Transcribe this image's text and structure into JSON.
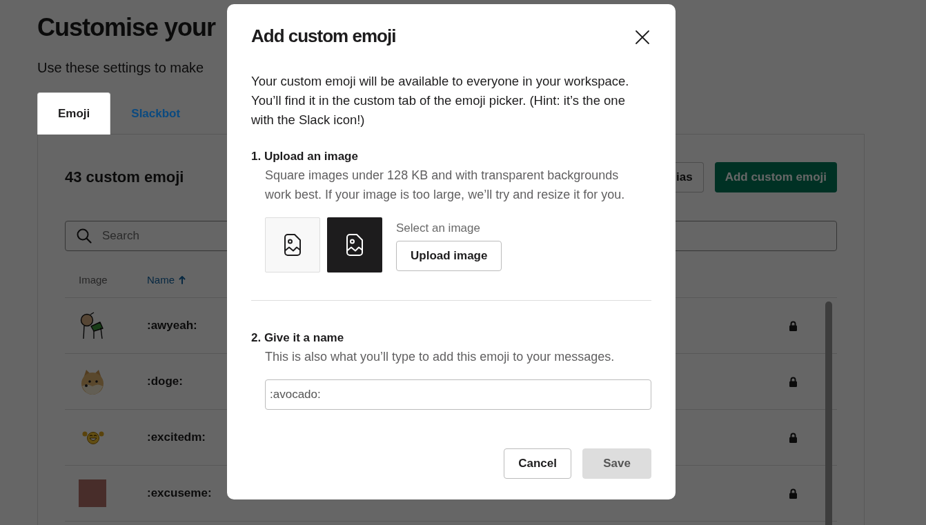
{
  "page": {
    "title": "Customise your",
    "subtitle": "Use these settings to make"
  },
  "tabs": [
    {
      "label": "Emoji",
      "selected": true
    },
    {
      "label": "Slackbot",
      "selected": false
    }
  ],
  "emoji_panel": {
    "heading": "43 custom emoji",
    "buttons": [
      {
        "label": "ias",
        "kind": "outline"
      },
      {
        "label": "Add custom emoji",
        "kind": "primary"
      }
    ],
    "search": {
      "placeholder": "Search"
    },
    "table": {
      "columns": [
        {
          "label": "Image",
          "sorted": false
        },
        {
          "label": "Name",
          "sorted": true
        }
      ],
      "rows": [
        {
          "kind": "figure",
          "name": ":awyeah:",
          "locked": true
        },
        {
          "kind": "dog",
          "name": ":doge:",
          "locked": true
        },
        {
          "kind": "smiley",
          "name": ":excitedm:",
          "locked": true
        },
        {
          "kind": "photo",
          "name": ":excuseme:",
          "locked": true
        }
      ]
    }
  },
  "modal": {
    "title": "Add custom emoji",
    "intro": "Your custom emoji will be available to everyone in your workspace. You’ll find it in the custom tab of the emoji picker. (Hint: it’s the one with the Slack icon!)",
    "steps": [
      {
        "kind": "upload",
        "heading": "1. Upload an image",
        "hint": "Square images under 128 KB and with transparent backgrounds work best. If your image is too large, we’ll try and resize it for you.",
        "file_label": "Select an image",
        "button": "Upload image"
      },
      {
        "kind": "name",
        "heading": "2. Give it a name",
        "hint": "This is also what you’ll type to add this emoji to your messages.",
        "input": {
          "value": ":avocado:"
        }
      }
    ],
    "buttons": [
      {
        "label": "Cancel",
        "kind": "secondary",
        "disabled": false
      },
      {
        "label": "Save",
        "kind": "primary",
        "disabled": true
      }
    ]
  }
}
